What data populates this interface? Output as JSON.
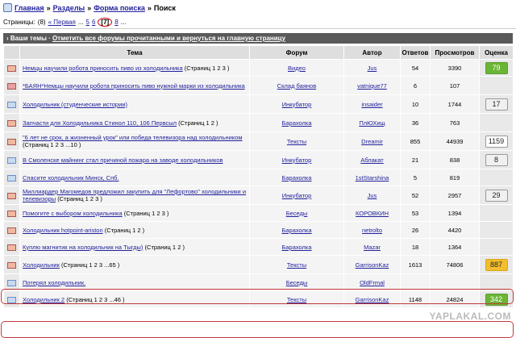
{
  "breadcrumb": {
    "home": "Главная",
    "sep": "»",
    "sections": "Разделы",
    "search_form": "Форма поиска",
    "current": "Поиск"
  },
  "pagination": {
    "label": "Страницы:",
    "count": "(8)",
    "first": "« Первая",
    "ellipsis": "...",
    "p5": "5",
    "p6": "6",
    "p7": "[7]",
    "p8": "8",
    "more": "..."
  },
  "topbar": {
    "title": "Ваши темы",
    "link": "Отметить все форумы прочитанными и вернуться на главную страницу"
  },
  "columns": {
    "topic": "Тема",
    "forum": "Форум",
    "author": "Автор",
    "replies": "Ответов",
    "views": "Просмотров",
    "rating": "Оценка"
  },
  "rows": [
    {
      "title": "Немцы научили робота приносить пиво из холодильника",
      "pages": "(Страниц 1 2 3 )",
      "forum": "Видео",
      "author": "Jus",
      "replies": "54",
      "views": "3390",
      "rating": "79",
      "icon": "red",
      "style": "green"
    },
    {
      "title": "*БАЯН*Немцы научили робота приносить пиво нужной марки из холодильника",
      "pages": "",
      "forum": "Склад баянов",
      "author": "vatnique77",
      "replies": "6",
      "views": "107",
      "rating": "",
      "icon": "pink",
      "style": ""
    },
    {
      "title": "Холодильник (студенческие истории)",
      "pages": "",
      "forum": "Инкубатор",
      "author": "insaider",
      "replies": "10",
      "views": "1744",
      "rating": "17",
      "icon": "blue",
      "style": "grey"
    },
    {
      "title": "Запчасти для Холодильника Стинол 110, 106 Первсыл",
      "pages": "(Страниц 1 2 )",
      "forum": "Барахолка",
      "author": "ПлЮХищ",
      "replies": "36",
      "views": "763",
      "rating": "",
      "icon": "red",
      "style": ""
    },
    {
      "title": "\"6 лет не срок, а жизненный урок\" или победа телевизора над холодильником",
      "pages": "(Страниц 1 2 3 ...10 )",
      "forum": "Тексты",
      "author": "Dreamir",
      "replies": "855",
      "views": "44939",
      "rating": "1159",
      "icon": "red",
      "style": "white"
    },
    {
      "title": "В Смоленске майнинг стал причиной пожара на заводе холодильников",
      "pages": "",
      "forum": "Инкубатор",
      "author": "Аблакат",
      "replies": "21",
      "views": "838",
      "rating": "8",
      "icon": "blue",
      "style": "grey"
    },
    {
      "title": "Спасите холодильник Минск, Спб.",
      "pages": "",
      "forum": "Барахолка",
      "author": "1stStarshina",
      "replies": "5",
      "views": "819",
      "rating": "",
      "icon": "blue",
      "style": ""
    },
    {
      "title": "Миллиардер Магомедов предложил закупить для \"Лефортово\" холодильники и телевизоры",
      "pages": "(Страниц 1 2 3 )",
      "forum": "Инкубатор",
      "author": "Jus",
      "replies": "52",
      "views": "2957",
      "rating": "29",
      "icon": "red",
      "style": "grey"
    },
    {
      "title": "Помогите с выбором холодильника",
      "pages": "(Страниц 1 2 3 )",
      "forum": "Беседы",
      "author": "КОРОВКИН",
      "replies": "53",
      "views": "1394",
      "rating": "",
      "icon": "red",
      "style": ""
    },
    {
      "title": "Холодильник hotpoint-ariston",
      "pages": "(Страниц 1 2 )",
      "forum": "Барахолка",
      "author": "netrolto",
      "replies": "26",
      "views": "4420",
      "rating": "",
      "icon": "red",
      "style": ""
    },
    {
      "title": "Куплю магнитик на холодильник на Тыгды)",
      "pages": "(Страниц 1 2 )",
      "forum": "Барахолка",
      "author": "Mazar",
      "replies": "18",
      "views": "1364",
      "rating": "",
      "icon": "red",
      "style": ""
    },
    {
      "title": "Холодильник",
      "pages": "(Страниц 1 2 3 ...65 )",
      "forum": "Тексты",
      "author": "GarrisonKaz",
      "replies": "1613",
      "views": "74806",
      "rating": "887",
      "icon": "red",
      "style": "gold"
    },
    {
      "title": "Потерял холодильник.",
      "pages": "",
      "forum": "Беседы",
      "author": "OldFrmal",
      "replies": "",
      "views": "",
      "rating": "",
      "icon": "blue",
      "style": ""
    },
    {
      "title": "Холодильник 2",
      "pages": "(Страниц 1 2 3 ...46 )",
      "forum": "Тексты",
      "author": "GarrisonKaz",
      "replies": "1148",
      "views": "24824",
      "rating": "342",
      "icon": "blue",
      "style": "green"
    }
  ],
  "watermark": "YAPLAKAL.COM"
}
